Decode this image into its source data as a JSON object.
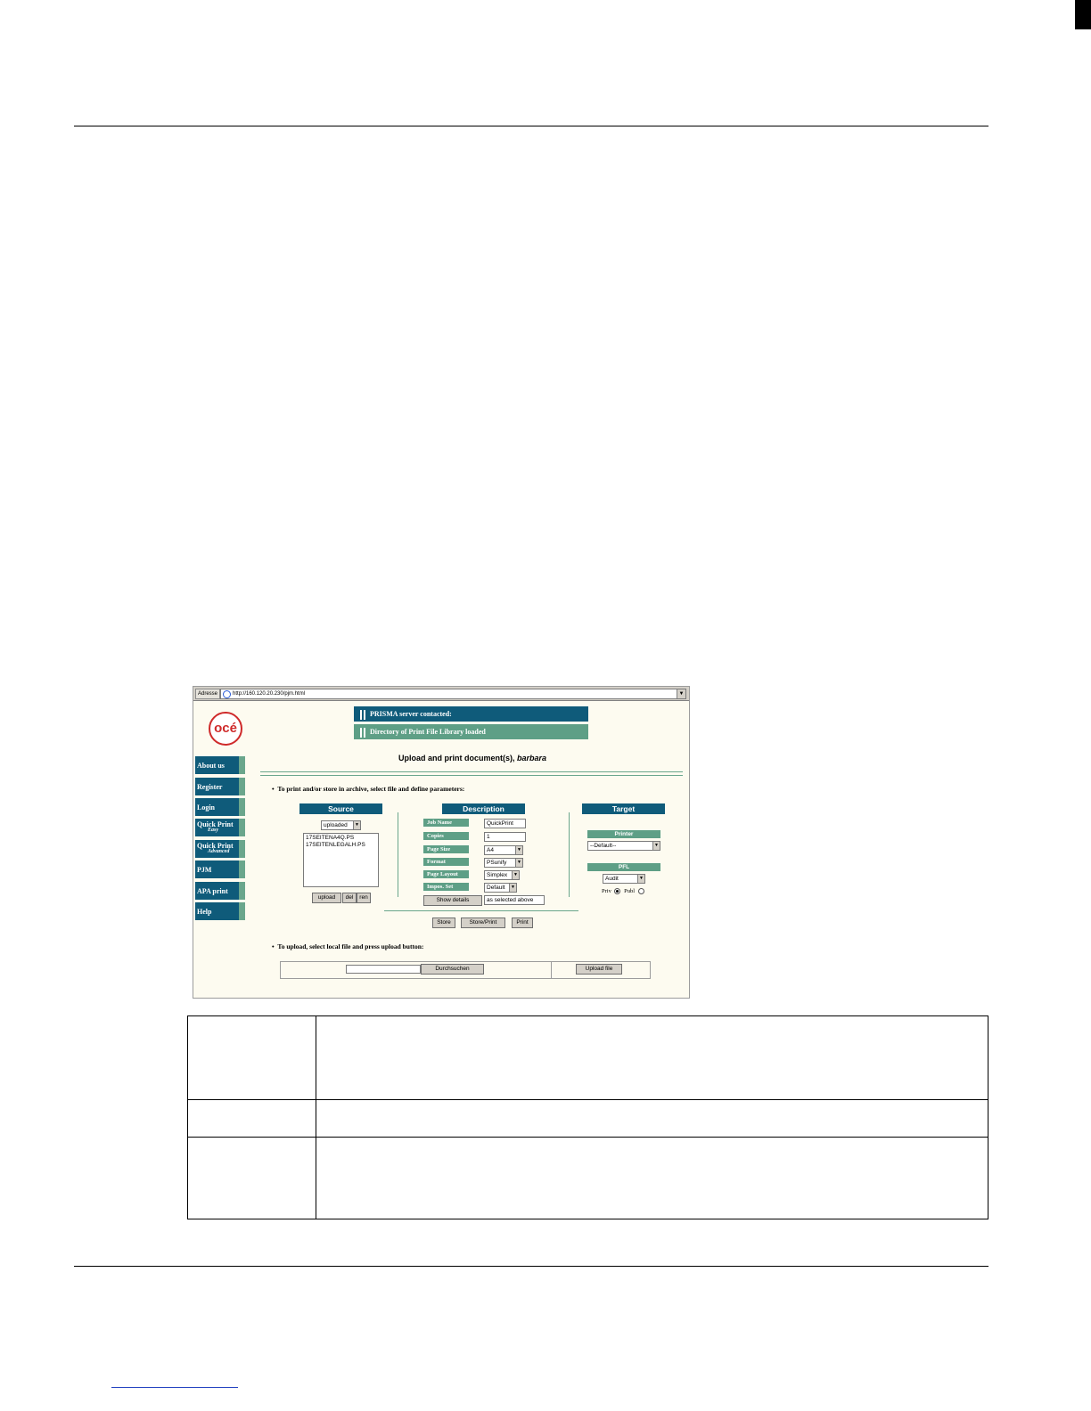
{
  "screenshot": {
    "address_bar": {
      "label": "Adresse",
      "url": "http://160.120.20.230/pjm.html"
    },
    "logo_text": "océ",
    "status_messages": [
      "PRISMA server contacted:",
      "Directory of Print File Library loaded"
    ],
    "nav_items": [
      {
        "label": "About us"
      },
      {
        "label": "Register"
      },
      {
        "label": "Login"
      },
      {
        "label": "Quick Print",
        "sub": "Easy"
      },
      {
        "label": "Quick Print",
        "sub": "Advanced"
      },
      {
        "label": "PJM"
      },
      {
        "label": "APA print"
      },
      {
        "label": "Help"
      }
    ],
    "page_title": {
      "text": "Upload and print document(s),",
      "user": "barbara"
    },
    "instruction_print": "To print and/or store in archive, select file and define parameters:",
    "source": {
      "header": "Source",
      "select_value": "uploaded",
      "files": [
        "17SEITENA4Q.PS",
        "17SEITENLEGALH.PS"
      ],
      "buttons": {
        "upload": "upload",
        "del": "del",
        "ren": "ren"
      }
    },
    "description": {
      "header": "Description",
      "fields": [
        {
          "label": "Job Name",
          "value": "QuickPrint"
        },
        {
          "label": "Copies",
          "value": "1"
        },
        {
          "label": "Page Size",
          "value": "A4"
        },
        {
          "label": "Format",
          "value": "PSunify"
        },
        {
          "label": "Page Layout",
          "value": "Simplex"
        },
        {
          "label": "Impos. Set",
          "value": "Default"
        }
      ],
      "show_details": "Show details",
      "details_value": "as selected above"
    },
    "target": {
      "header": "Target",
      "printer_label": "Printer",
      "printer_value": "--Default--",
      "pfl_label": "PFL",
      "pfl_value": "Audit",
      "priv_label": "Priv",
      "publ_label": "Publ",
      "selected": "Priv"
    },
    "action_buttons": {
      "store": "Store",
      "store_print": "Store/Print",
      "print": "Print"
    },
    "instruction_upload": "To upload, select local file and press upload button:",
    "upload": {
      "browse": "Durchsuchen",
      "upload_file": "Upload file"
    }
  },
  "colors": {
    "nav_blue": "#0f5b7a",
    "accent_green": "#5e9f86",
    "page_bg": "#fdfbf0",
    "logo_red": "#cf2a2a"
  }
}
